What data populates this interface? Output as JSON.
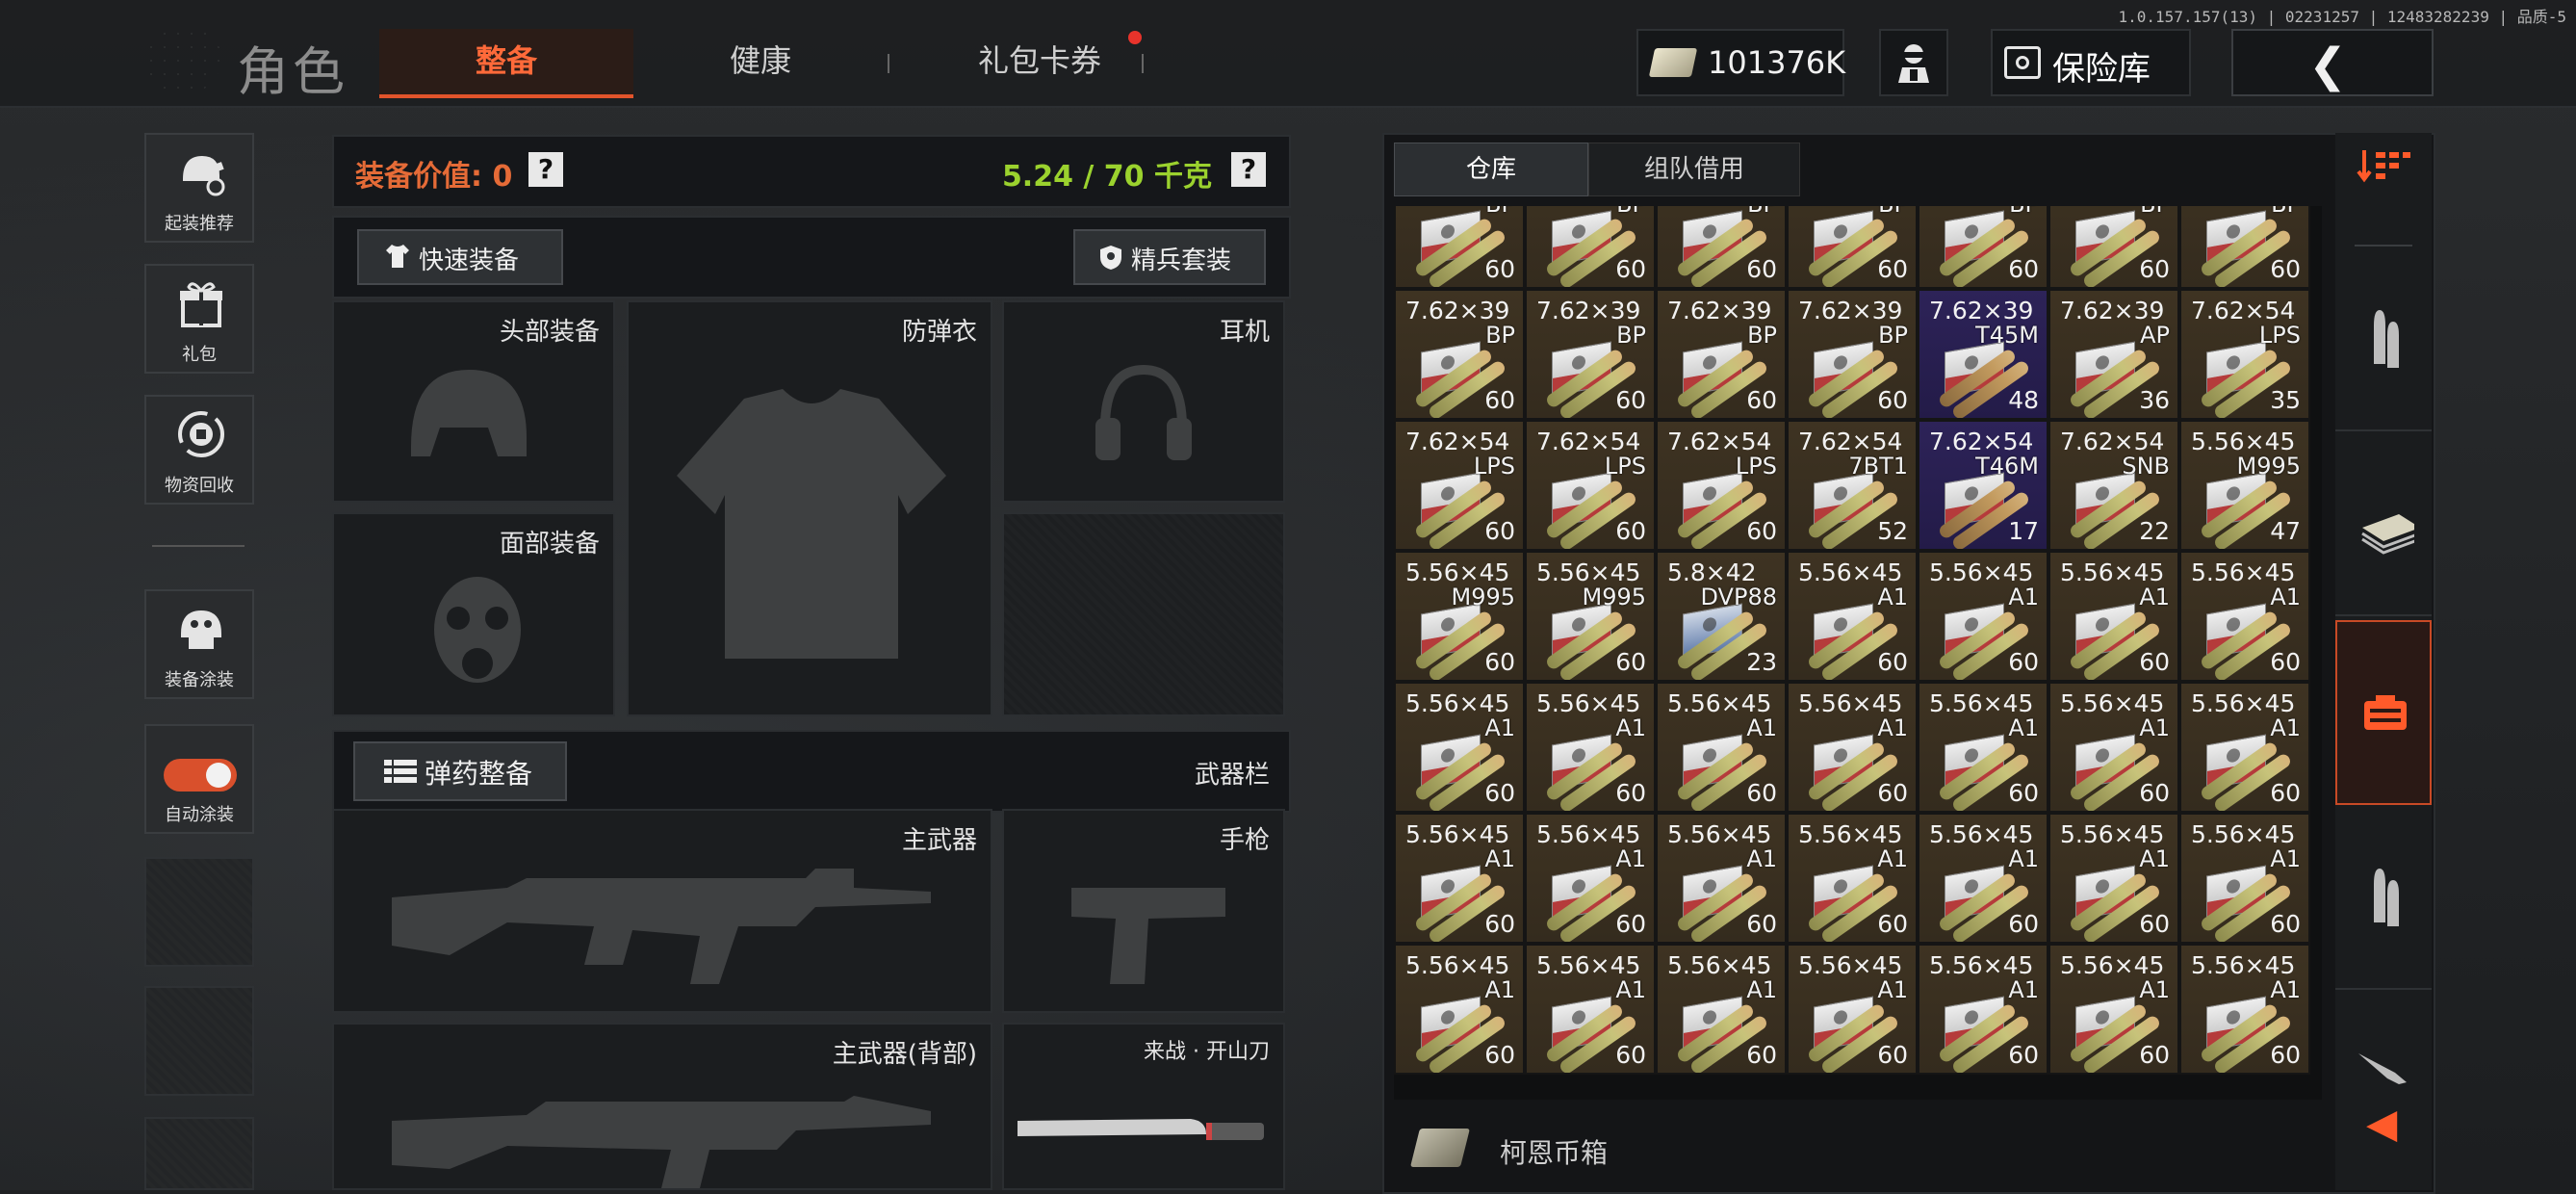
{
  "header": {
    "title": "角色",
    "tabs": [
      {
        "label": "整备",
        "active": true
      },
      {
        "label": "健康",
        "active": false
      },
      {
        "label": "礼包卡券",
        "active": false
      }
    ],
    "version": "1.0.157.157(13) | 02231257 | 12483282239 | 品质-5",
    "money": "101376K",
    "vault_label": "保险库"
  },
  "sidebar": {
    "items": [
      {
        "label": "起装推荐",
        "icon": "helmet-recommend-icon"
      },
      {
        "label": "礼包",
        "icon": "gift-icon"
      },
      {
        "label": "物资回收",
        "icon": "recycle-icon"
      },
      {
        "label": "装备涂装",
        "icon": "paint-helmet-icon"
      },
      {
        "label": "自动涂装",
        "icon": "toggle-icon",
        "toggle_on": true
      }
    ]
  },
  "equipment": {
    "value_label": "装备价值: 0",
    "weight_label": "5.24 / 70 千克",
    "help": "?",
    "quick_equip": "快速装备",
    "elite_set": "精兵套装",
    "slots": {
      "head": "头部装备",
      "armor": "防弹衣",
      "headset": "耳机",
      "face": "面部装备",
      "primary": "主武器",
      "pistol": "手枪",
      "primary_back": "主武器(背部)",
      "melee": "来战 · 开山刀"
    },
    "ammo_button": "弹药整备",
    "weapon_bar_label": "武器栏"
  },
  "inventory": {
    "tabs": [
      {
        "label": "仓库",
        "active": true
      },
      {
        "label": "组队借用",
        "active": false
      }
    ],
    "items": [
      {
        "cal": "",
        "type": "BP",
        "qty": "60",
        "rarity": "normal"
      },
      {
        "cal": "",
        "type": "BP",
        "qty": "60",
        "rarity": "normal"
      },
      {
        "cal": "",
        "type": "BP",
        "qty": "60",
        "rarity": "normal"
      },
      {
        "cal": "",
        "type": "BP",
        "qty": "60",
        "rarity": "normal"
      },
      {
        "cal": "",
        "type": "BP",
        "qty": "60",
        "rarity": "normal"
      },
      {
        "cal": "",
        "type": "BP",
        "qty": "60",
        "rarity": "normal"
      },
      {
        "cal": "",
        "type": "BP",
        "qty": "60",
        "rarity": "normal"
      },
      {
        "cal": "7.62×39",
        "type": "BP",
        "qty": "60",
        "rarity": "normal"
      },
      {
        "cal": "7.62×39",
        "type": "BP",
        "qty": "60",
        "rarity": "normal"
      },
      {
        "cal": "7.62×39",
        "type": "BP",
        "qty": "60",
        "rarity": "normal"
      },
      {
        "cal": "7.62×39",
        "type": "BP",
        "qty": "60",
        "rarity": "normal"
      },
      {
        "cal": "7.62×39",
        "type": "T45M",
        "qty": "48",
        "rarity": "purple"
      },
      {
        "cal": "7.62×39",
        "type": "AP",
        "qty": "36",
        "rarity": "normal"
      },
      {
        "cal": "7.62×54",
        "type": "LPS",
        "qty": "35",
        "rarity": "normal"
      },
      {
        "cal": "7.62×54",
        "type": "LPS",
        "qty": "60",
        "rarity": "normal"
      },
      {
        "cal": "7.62×54",
        "type": "LPS",
        "qty": "60",
        "rarity": "normal"
      },
      {
        "cal": "7.62×54",
        "type": "LPS",
        "qty": "60",
        "rarity": "normal"
      },
      {
        "cal": "7.62×54",
        "type": "7BT1",
        "qty": "52",
        "rarity": "normal"
      },
      {
        "cal": "7.62×54",
        "type": "T46M",
        "qty": "17",
        "rarity": "purple"
      },
      {
        "cal": "7.62×54",
        "type": "SNB",
        "qty": "22",
        "rarity": "normal"
      },
      {
        "cal": "5.56×45",
        "type": "M995",
        "qty": "47",
        "rarity": "normal"
      },
      {
        "cal": "5.56×45",
        "type": "M995",
        "qty": "60",
        "rarity": "normal"
      },
      {
        "cal": "5.56×45",
        "type": "M995",
        "qty": "60",
        "rarity": "normal"
      },
      {
        "cal": "5.8×42",
        "type": "DVP88",
        "qty": "23",
        "rarity": "blue"
      },
      {
        "cal": "5.56×45",
        "type": "A1",
        "qty": "60",
        "rarity": "normal"
      },
      {
        "cal": "5.56×45",
        "type": "A1",
        "qty": "60",
        "rarity": "normal"
      },
      {
        "cal": "5.56×45",
        "type": "A1",
        "qty": "60",
        "rarity": "normal"
      },
      {
        "cal": "5.56×45",
        "type": "A1",
        "qty": "60",
        "rarity": "normal"
      },
      {
        "cal": "5.56×45",
        "type": "A1",
        "qty": "60",
        "rarity": "normal"
      },
      {
        "cal": "5.56×45",
        "type": "A1",
        "qty": "60",
        "rarity": "normal"
      },
      {
        "cal": "5.56×45",
        "type": "A1",
        "qty": "60",
        "rarity": "normal"
      },
      {
        "cal": "5.56×45",
        "type": "A1",
        "qty": "60",
        "rarity": "normal"
      },
      {
        "cal": "5.56×45",
        "type": "A1",
        "qty": "60",
        "rarity": "normal"
      },
      {
        "cal": "5.56×45",
        "type": "A1",
        "qty": "60",
        "rarity": "normal"
      },
      {
        "cal": "5.56×45",
        "type": "A1",
        "qty": "60",
        "rarity": "normal"
      },
      {
        "cal": "5.56×45",
        "type": "A1",
        "qty": "60",
        "rarity": "normal"
      },
      {
        "cal": "5.56×45",
        "type": "A1",
        "qty": "60",
        "rarity": "normal"
      },
      {
        "cal": "5.56×45",
        "type": "A1",
        "qty": "60",
        "rarity": "normal"
      },
      {
        "cal": "5.56×45",
        "type": "A1",
        "qty": "60",
        "rarity": "normal"
      },
      {
        "cal": "5.56×45",
        "type": "A1",
        "qty": "60",
        "rarity": "normal"
      },
      {
        "cal": "5.56×45",
        "type": "A1",
        "qty": "60",
        "rarity": "normal"
      },
      {
        "cal": "5.56×45",
        "type": "A1",
        "qty": "60",
        "rarity": "normal"
      },
      {
        "cal": "5.56×45",
        "type": "A1",
        "qty": "60",
        "rarity": "normal"
      },
      {
        "cal": "5.56×45",
        "type": "A1",
        "qty": "60",
        "rarity": "normal"
      },
      {
        "cal": "5.56×45",
        "type": "A1",
        "qty": "60",
        "rarity": "normal"
      },
      {
        "cal": "5.56×45",
        "type": "A1",
        "qty": "60",
        "rarity": "normal"
      },
      {
        "cal": "5.56×45",
        "type": "A1",
        "qty": "60",
        "rarity": "normal"
      },
      {
        "cal": "5.56×45",
        "type": "A1",
        "qty": "60",
        "rarity": "normal"
      },
      {
        "cal": "5.56×45",
        "type": "A1",
        "qty": "60",
        "rarity": "normal"
      }
    ],
    "footer_label": "柯恩币箱"
  },
  "categories": [
    {
      "icon": "sort-icon"
    },
    {
      "icon": "ammo-icon"
    },
    {
      "icon": "money-stack-icon"
    },
    {
      "icon": "ammo-crate-icon",
      "active": true
    },
    {
      "icon": "ammo-icon"
    },
    {
      "icon": "knife-icon"
    }
  ],
  "colors": {
    "accent": "#e2542b",
    "weight": "#9bd22e",
    "value": "#e56b37",
    "cell_normal": "#3e3322",
    "cell_purple": "#2d2358"
  }
}
